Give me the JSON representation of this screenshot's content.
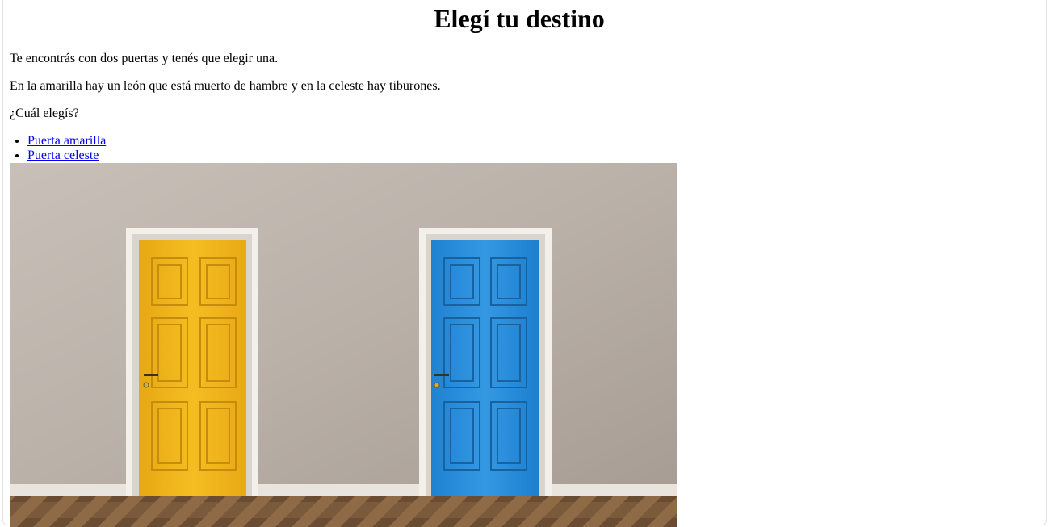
{
  "page": {
    "title": "Elegí tu destino",
    "paragraphs": [
      "Te encontrás con dos puertas y tenés que elegir una.",
      "En la amarilla hay un león que está muerto de hambre y en la celeste hay tiburones.",
      "¿Cuál elegís?"
    ],
    "links": [
      {
        "label": "Puerta amarilla"
      },
      {
        "label": "Puerta celeste"
      }
    ]
  },
  "image": {
    "description_icon": "two-doors-illustration",
    "colors": {
      "wall": "#b9b0a8",
      "yellow_door": "#f2b71b",
      "blue_door": "#2a8fdc",
      "frame": "#f4f1ec",
      "floor": "#7a5a3c"
    }
  }
}
